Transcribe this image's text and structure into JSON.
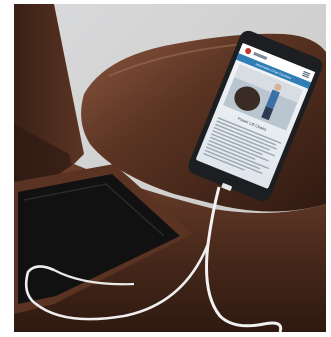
{
  "photo": {
    "subject": "reclining-chair-console-with-smartphone-charging",
    "colors": {
      "leather": "#4a2a1c",
      "leather_highlight": "#7a4a34",
      "storage_interior": "#111111",
      "cable": "#f2f2f2",
      "phone_body": "#1c1e22",
      "screen_bg": "#e9eef3",
      "site_header": "#2f7fb6"
    }
  },
  "phone_screen": {
    "header_title": "Information Chair Furniture",
    "article_heading": "Power Lift Chairs"
  }
}
